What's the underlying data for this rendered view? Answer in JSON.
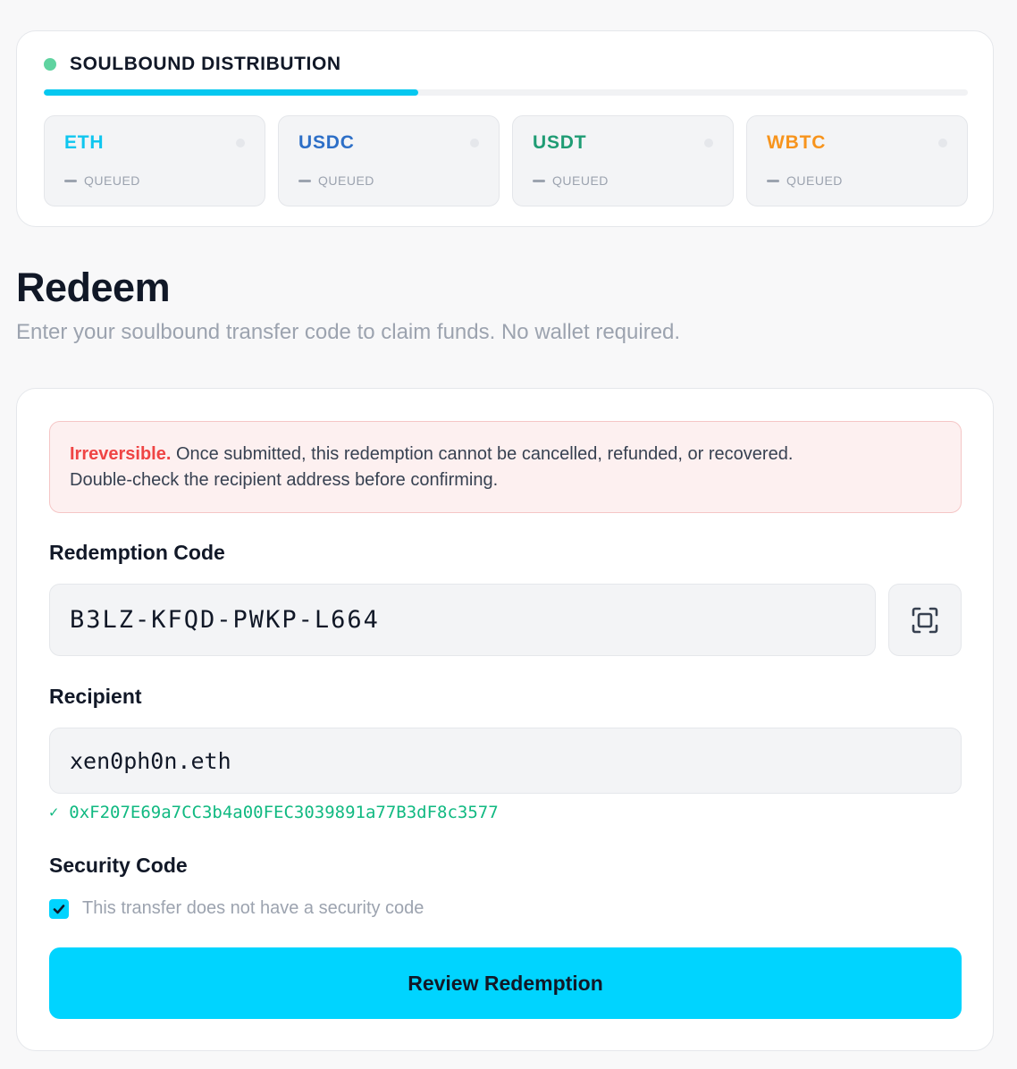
{
  "distribution": {
    "title": "SOULBOUND DISTRIBUTION",
    "status_color": "#5fd3a0",
    "progress": 0.405,
    "progress_color": "#06c8f0",
    "tokens": [
      {
        "symbol": "ETH",
        "status": "QUEUED",
        "color": "#0fc6ef"
      },
      {
        "symbol": "USDC",
        "status": "QUEUED",
        "color": "#2d6fc7"
      },
      {
        "symbol": "USDT",
        "status": "QUEUED",
        "color": "#1f9c74"
      },
      {
        "symbol": "WBTC",
        "status": "QUEUED",
        "color": "#f7941d"
      }
    ]
  },
  "page": {
    "title": "Redeem",
    "subtitle": "Enter your soulbound transfer code to claim funds. No wallet required."
  },
  "warning": {
    "strong": "Irreversible.",
    "line1": " Once submitted, this redemption cannot be cancelled, refunded, or recovered.",
    "line2": "Double-check the recipient address before confirming."
  },
  "redemption_code": {
    "label": "Redemption Code",
    "value": "B3LZ-KFQD-PWKP-L664",
    "scan_icon": "scan-icon"
  },
  "recipient": {
    "label": "Recipient",
    "value": "xen0ph0n.eth",
    "check": "✓",
    "resolved_address": "0xF207E69a7CC3b4a00FEC3039891a77B3dF8c3577",
    "resolved_color": "#10b981"
  },
  "security": {
    "label": "Security Code",
    "checked": true,
    "checkbox_label": "This transfer does not have a security code"
  },
  "actions": {
    "review_label": "Review Redemption",
    "review_color": "#00d4ff"
  }
}
